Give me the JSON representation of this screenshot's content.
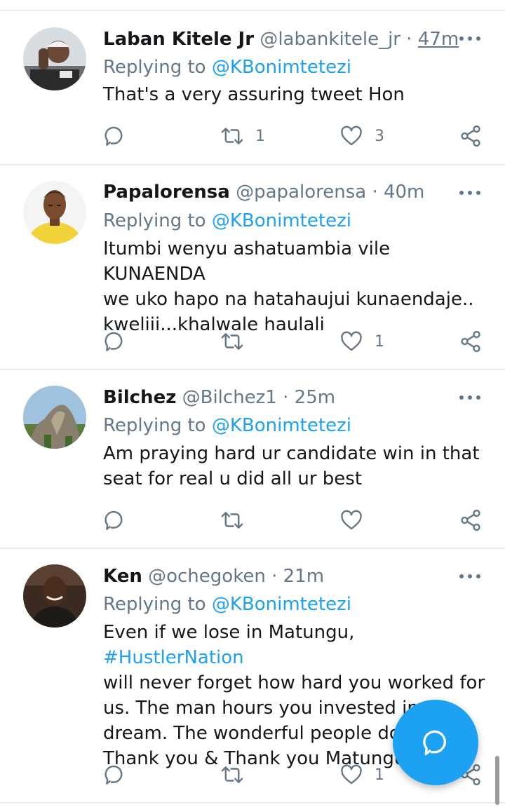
{
  "tweets": [
    {
      "name": "Laban Kitele Jr",
      "handle": "@labankitele_jr",
      "separator": "·",
      "time": "47m",
      "replying_prefix": "Replying to",
      "replying_to": "@KBonimtetezi",
      "text": "That's a very assuring tweet Hon",
      "retweets": "1",
      "likes": "3"
    },
    {
      "name": "Papalorensa",
      "handle": "@papalorensa",
      "separator": "·",
      "time": "40m",
      "replying_prefix": "Replying to",
      "replying_to": "@KBonimtetezi",
      "text": "Itumbi wenyu ashatuambia vile KUNAENDA\nwe uko hapo na hatahaujui kunaendaje..\nkweliii...khalwale haulali",
      "retweets": "",
      "likes": "1"
    },
    {
      "name": "Bilchez",
      "handle": "@Bilchez1",
      "separator": "·",
      "time": "25m",
      "replying_prefix": "Replying to",
      "replying_to": "@KBonimtetezi",
      "text": "Am praying hard ur candidate win in that\nseat for real u did all ur best",
      "retweets": "",
      "likes": ""
    },
    {
      "name": "Ken",
      "handle": "@ochegoken",
      "separator": "·",
      "time": "21m",
      "replying_prefix": "Replying to",
      "replying_to": "@KBonimtetezi",
      "text_before": "Even if we lose in Matungu, ",
      "hashtag": "#HustlerNation",
      "text_after": "\n will never forget  how hard you worked for\nus. The man hours you invested in the\ndream. The wonderful people down t\nThank you & Thank you Matungu.",
      "retweets": "",
      "likes": "1"
    }
  ],
  "icons": {
    "reply": "reply-icon",
    "retweet": "retweet-icon",
    "like": "heart-icon",
    "share": "share-icon",
    "more": "more-icon",
    "compose": "compose-reply-icon"
  },
  "colors": {
    "accent": "#1da1f2",
    "secondary_text": "#657786",
    "divider": "#e6ecf0"
  }
}
